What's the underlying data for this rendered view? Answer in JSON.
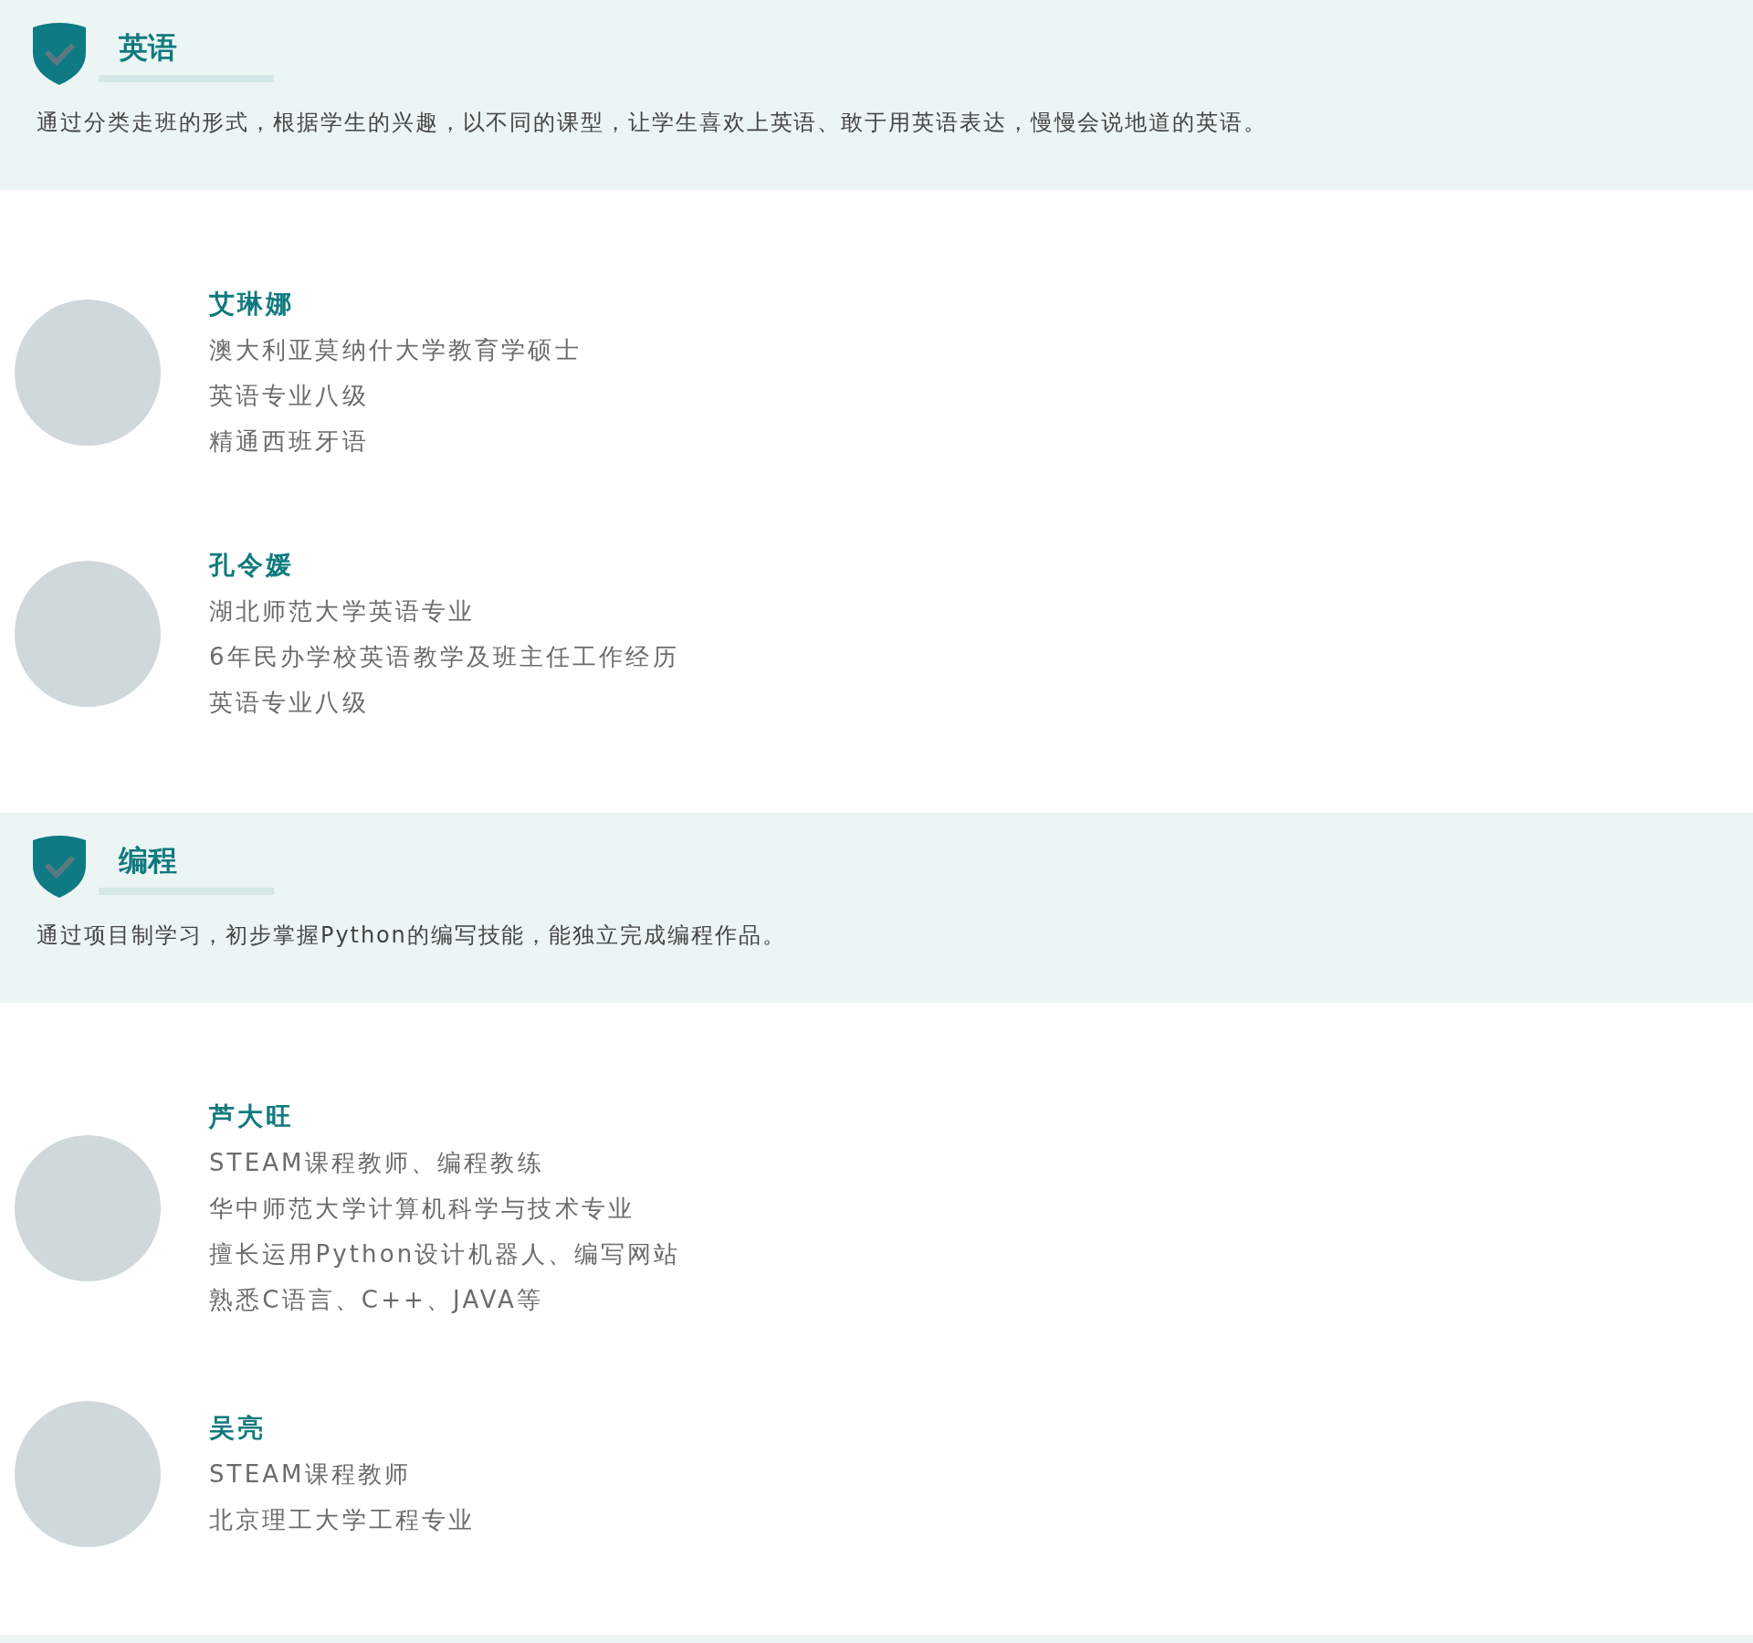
{
  "sections": [
    {
      "title": "英语",
      "description": "通过分类走班的形式，根据学生的兴趣，以不同的课型，让学生喜欢上英语、敢于用英语表达，慢慢会说地道的英语。",
      "teachers": [
        {
          "name": "艾琳娜",
          "lines": [
            "澳大利亚莫纳什大学教育学硕士",
            "英语专业八级",
            "精通西班牙语"
          ]
        },
        {
          "name": "孔令媛",
          "lines": [
            "湖北师范大学英语专业",
            "6年民办学校英语教学及班主任工作经历",
            "英语专业八级"
          ]
        }
      ]
    },
    {
      "title": "编程",
      "description": "通过项目制学习，初步掌握Python的编写技能，能独立完成编程作品。",
      "teachers": [
        {
          "name": "芦大旺",
          "lines": [
            "STEAM课程教师、编程教练",
            "华中师范大学计算机科学与技术专业",
            "擅长运用Python设计机器人、编写网站",
            "熟悉C语言、C++、JAVA等"
          ]
        },
        {
          "name": "吴亮",
          "lines": [
            "STEAM课程教师",
            "北京理工大学工程专业"
          ]
        }
      ]
    }
  ]
}
